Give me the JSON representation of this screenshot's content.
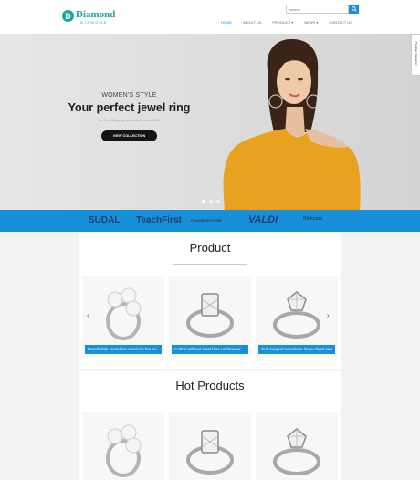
{
  "header": {
    "logo_name": "Diamond",
    "logo_sub": "DIAMOND",
    "logo_mark": "D",
    "search_placeholder": "search",
    "search_icon": "search-icon",
    "nav": [
      {
        "label": "HOME"
      },
      {
        "label": "ABOUT US"
      },
      {
        "label": "PRODUCT ▾"
      },
      {
        "label": "NEWS ▾"
      },
      {
        "label": "CONTACT US"
      }
    ]
  },
  "hero": {
    "kicker": "WOMEN'S STYLE",
    "title": "Your perfect jewel ring",
    "subtitle": "Get Free Shipping on all orders over $99.99",
    "button": "VIEW COLLECTION",
    "online_service": "Online Service"
  },
  "brands": [
    "SUDAL",
    "TeachFirst",
    "FLAGSHIPSTORE",
    "VALDI",
    "Rinkcom"
  ],
  "product_section": {
    "title": "Product",
    "prev_icon": "chevron-left-icon",
    "next_icon": "chevron-right-icon",
    "cards": [
      {
        "caption": "Breathable seamless steel rim bra un...",
        "image": "pearl-ring"
      },
      {
        "caption": "Cotton without insert bra underwear",
        "image": "diamond-ring"
      },
      {
        "caption": "Soft support seamless large chest sen...",
        "image": "solitaire-ring"
      }
    ]
  },
  "hot_section": {
    "title": "Hot Products",
    "cards": [
      {
        "image": "pearl-ring"
      },
      {
        "image": "diamond-ring"
      },
      {
        "image": "solitaire-ring"
      }
    ]
  },
  "colors": {
    "accent": "#1790d9",
    "brand": "#19a99b",
    "hero_shirt": "#e9a21f"
  }
}
